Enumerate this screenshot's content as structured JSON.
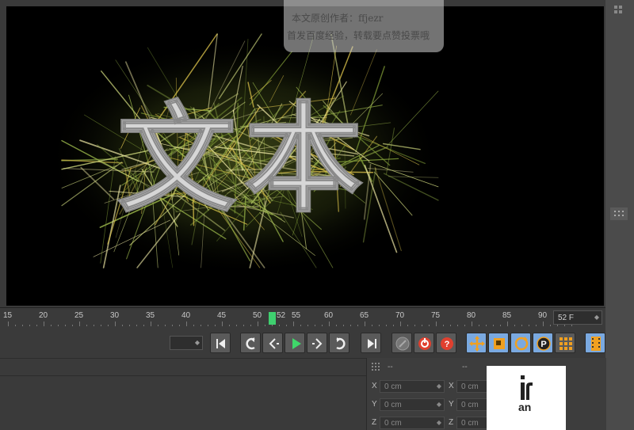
{
  "watermark": {
    "line1": "本文原创作者：ffjezr",
    "line2": "首发百度经验，转载要点赞投票哦"
  },
  "viewport": {
    "render_text": "文本",
    "colors": {
      "background": "#000000",
      "text_fill": "#d8d8d8",
      "hair_green": "#9ab64a",
      "hair_yellow": "#d9c04a"
    }
  },
  "timeline": {
    "ticks": [
      "15",
      "20",
      "25",
      "30",
      "35",
      "40",
      "45",
      "50",
      "55",
      "60",
      "65",
      "70",
      "75",
      "80",
      "85",
      "90"
    ],
    "current_frame_label": "52",
    "end_frame_field": "52 F"
  },
  "transport": {
    "buttons": [
      {
        "name": "go-to-start-button",
        "icon": "go-to-start-icon"
      },
      {
        "name": "previous-key-button",
        "icon": "previous-key-icon"
      },
      {
        "name": "previous-frame-button",
        "icon": "previous-frame-icon"
      },
      {
        "name": "play-button",
        "icon": "play-icon"
      },
      {
        "name": "next-frame-button",
        "icon": "next-frame-icon"
      },
      {
        "name": "next-key-button",
        "icon": "next-key-icon"
      },
      {
        "name": "go-to-end-button",
        "icon": "go-to-end-icon"
      },
      {
        "name": "motion-record-button",
        "icon": "motion-record-icon"
      },
      {
        "name": "record-active-button",
        "icon": "record-icon"
      },
      {
        "name": "autokey-button",
        "icon": "autokey-icon"
      },
      {
        "name": "move-key-button",
        "icon": "move-icon"
      },
      {
        "name": "scale-key-button",
        "icon": "scale-icon"
      },
      {
        "name": "rotate-key-button",
        "icon": "rotate-icon"
      },
      {
        "name": "param-key-button",
        "icon": "param-p-icon"
      },
      {
        "name": "point-level-button",
        "icon": "grid-dots-icon"
      },
      {
        "name": "timeline-window-button",
        "icon": "film-icon"
      }
    ]
  },
  "coordinates": {
    "header_left": "--",
    "header_right": "--",
    "rows": [
      {
        "axis": "X",
        "left_value": "0 cm",
        "right_axis": "X",
        "right_value": "0 cm"
      },
      {
        "axis": "Y",
        "left_value": "0 cm",
        "right_axis": "Y",
        "right_value": "0 cm"
      },
      {
        "axis": "Z",
        "left_value": "0 cm",
        "right_axis": "Z",
        "right_value": "0 cm"
      }
    ]
  },
  "corner_text": "an"
}
